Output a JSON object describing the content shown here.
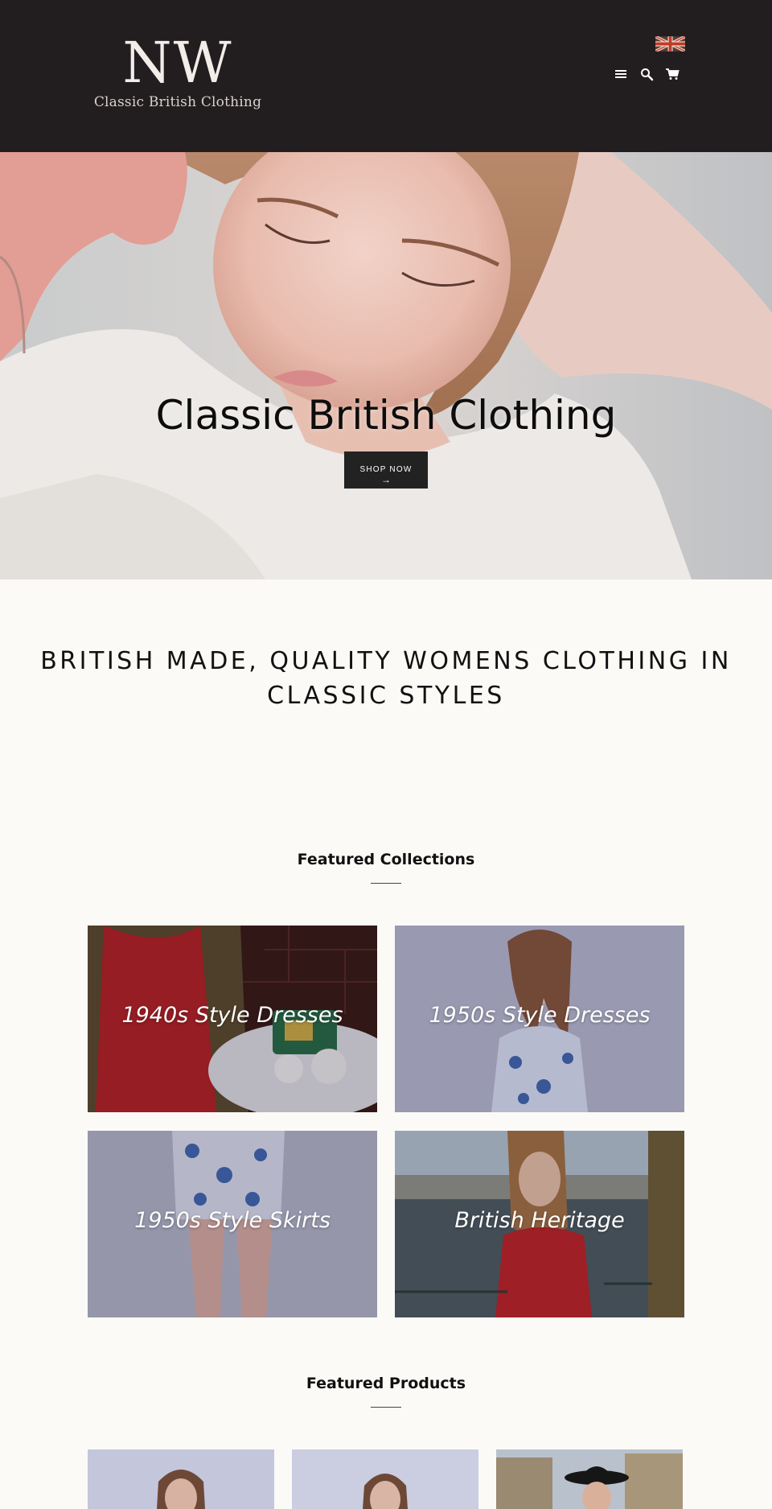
{
  "header": {
    "logo_mark": "NW",
    "logo_subtitle": "Classic British Clothing",
    "icons": [
      "uk-flag-icon",
      "menu-icon",
      "search-icon",
      "cart-icon"
    ]
  },
  "hero": {
    "title": "Classic British Clothing",
    "button_label": "SHOP NOW",
    "button_arrow": "→"
  },
  "tagline": "BRITISH MADE, QUALITY WOMENS CLOTHING IN CLASSIC STYLES",
  "featured_collections": {
    "title": "Featured Collections",
    "items": [
      {
        "label": "1940s Style Dresses"
      },
      {
        "label": "1950s Style Dresses"
      },
      {
        "label": "1950s Style Skirts"
      },
      {
        "label": "British Heritage"
      }
    ]
  },
  "featured_products": {
    "title": "Featured Products"
  },
  "colors": {
    "header_bg": "#221e20",
    "page_bg": "#fbfaf7",
    "button_bg": "#222222"
  }
}
